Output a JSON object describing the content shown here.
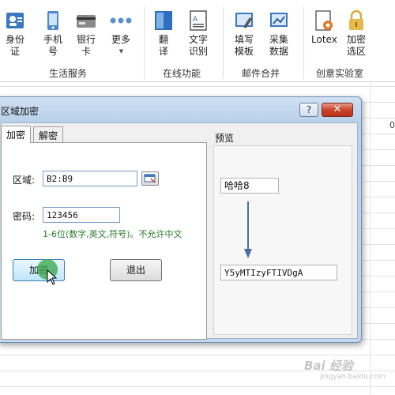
{
  "ribbon": {
    "groups": [
      {
        "label": "生活服务",
        "buttons": [
          {
            "label": "身份\n证",
            "icon": "id-card-icon"
          },
          {
            "label": "手机\n号",
            "icon": "phone-icon"
          },
          {
            "label": "银行\n卡",
            "icon": "bank-card-icon"
          },
          {
            "label": "更多",
            "icon": "more-icon"
          }
        ]
      },
      {
        "label": "在线功能",
        "buttons": [
          {
            "label": "翻\n译",
            "icon": "translate-icon"
          },
          {
            "label": "文字\n识别",
            "icon": "ocr-icon"
          }
        ]
      },
      {
        "label": "邮件合并",
        "buttons": [
          {
            "label": "填写\n模板",
            "icon": "fill-template-icon"
          },
          {
            "label": "采集\n数据",
            "icon": "collect-data-icon"
          }
        ]
      },
      {
        "label": "创意实验室",
        "buttons": [
          {
            "label": "Lotex",
            "icon": "lotex-icon"
          },
          {
            "label": "加密\n选区",
            "icon": "encrypt-selection-icon"
          }
        ]
      }
    ]
  },
  "sheet": {
    "column_number": "0"
  },
  "dialog": {
    "title": "区域加密",
    "help_label": "?",
    "close_label": "✕",
    "tabs": [
      "加密",
      "解密"
    ],
    "region_label": "区域:",
    "region_value": "B2:B9",
    "password_label": "密码:",
    "password_value": "123456",
    "hint": "1-6位(数字,英文,符号)。不允许中文",
    "encrypt_button": "加密",
    "exit_button": "退出",
    "preview_label": "预览",
    "preview_input": "哈哈8",
    "preview_output": "Y5yMTIzyFTIVDgA"
  },
  "watermark": {
    "text": "Bai 经验",
    "sub": "jingyan.baidu.com"
  }
}
